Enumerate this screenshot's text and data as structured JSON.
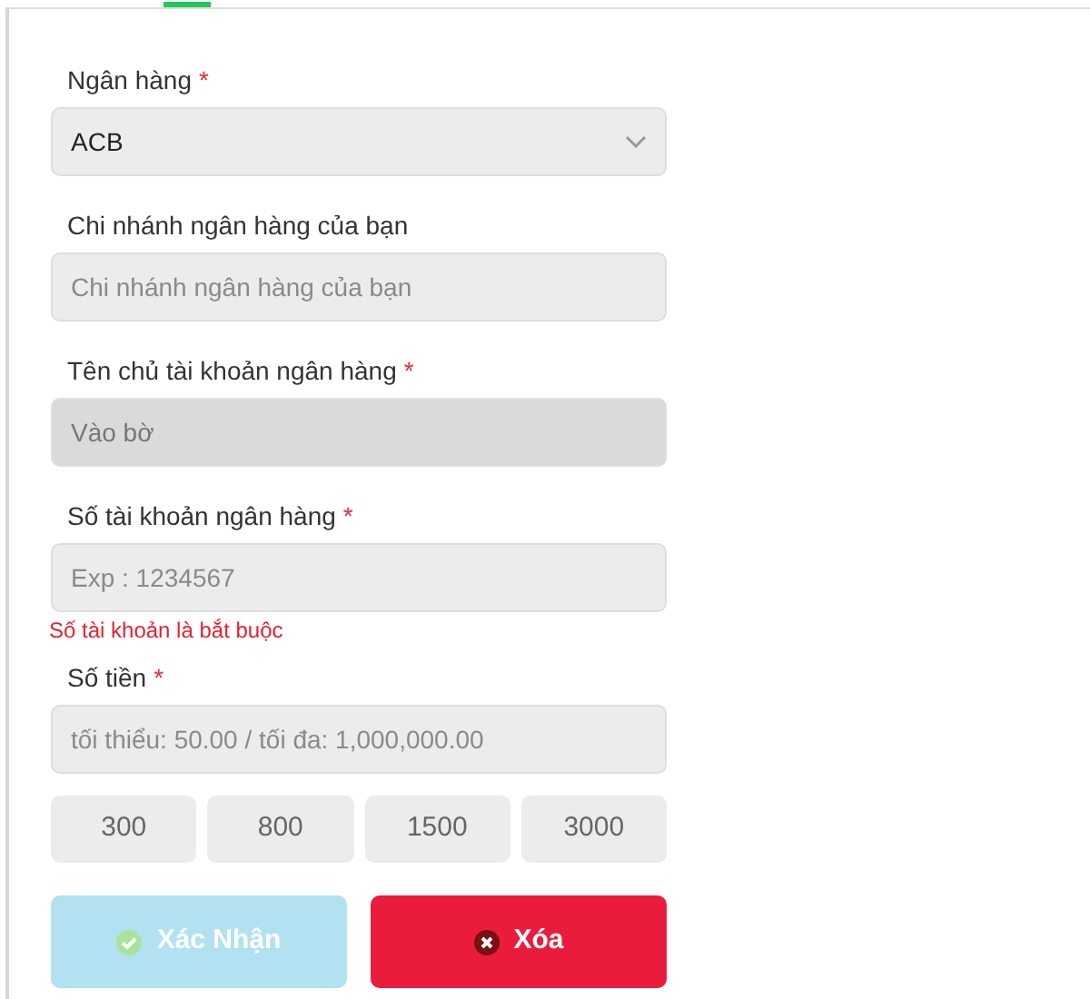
{
  "tab_indicator": {
    "selected": true
  },
  "fields": [
    {
      "kind": "select",
      "label": "Ngân hàng",
      "required_mark": "*",
      "value": "ACB",
      "disabled": false
    },
    {
      "kind": "input",
      "label": "Chi nhánh ngân hàng của bạn",
      "placeholder": "Chi nhánh ngân hàng của bạn",
      "disabled": false
    },
    {
      "kind": "input",
      "label": "Tên chủ tài khoản ngân hàng",
      "required_mark": "*",
      "value": "Vào bờ",
      "disabled": true
    },
    {
      "kind": "input",
      "label": "Số tài khoản ngân hàng",
      "required_mark": "*",
      "placeholder": "Exp : 1234567",
      "disabled": false,
      "error": "Số tài khoản là bắt buộc"
    },
    {
      "kind": "input",
      "label": "Số tiền",
      "required_mark": "*",
      "placeholder": "tối thiểu: 50.00 / tối đa: 1,000,000.00",
      "disabled": false
    }
  ],
  "quick_amounts": [
    "300",
    "800",
    "1500",
    "3000"
  ],
  "buttons": [
    {
      "kind": "confirm",
      "label": "Xác Nhận",
      "disabled": true
    },
    {
      "kind": "delete",
      "label": "Xóa",
      "disabled": false
    }
  ]
}
